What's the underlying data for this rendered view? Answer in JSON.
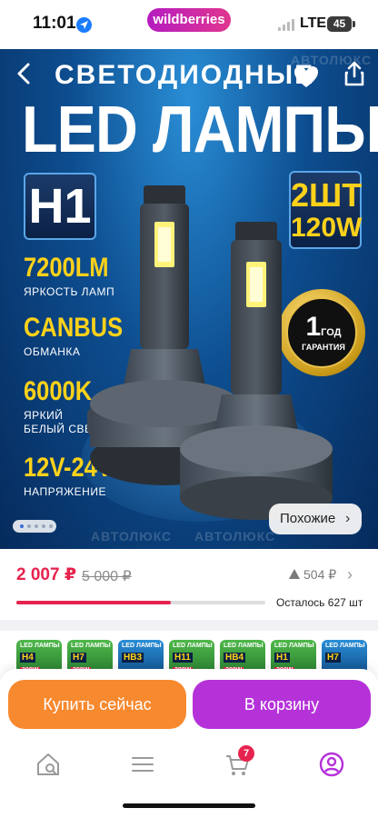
{
  "status_bar": {
    "time": "11:01",
    "brand": "wildberries",
    "network": "LTE",
    "battery": "45"
  },
  "hero": {
    "headline_top": "СВЕТОДИОДНЫЕ",
    "headline_main": "LED ЛАМПЫ",
    "base_type": "H1",
    "quantity": "2ШТ",
    "power": "120W",
    "specs": [
      {
        "value": "7200LM",
        "caption": "ЯРКОСТЬ ЛАМП"
      },
      {
        "value": "CANBUS",
        "caption": "ОБМАНКА"
      },
      {
        "value": "6000K",
        "caption": "ЯРКИЙ БЕЛЫЙ СВЕТ"
      },
      {
        "value": "12V-24V",
        "caption": "НАПРЯЖЕНИЕ"
      }
    ],
    "warranty_value": "1",
    "warranty_unit": "ГОД",
    "warranty_caption": "ГАРАНТИЯ",
    "watermark": "АВТОЛЮКС",
    "similar_label": "Похожие",
    "similar_arrow": "›",
    "gallery_count": 5,
    "gallery_active": 0
  },
  "price": {
    "current": "2 007 ₽",
    "old": "5 000 ₽",
    "trend": "504 ₽",
    "stock_text": "Осталось 627 шт",
    "stock_bar_fraction": 0.62,
    "accent": "#e6234e"
  },
  "variants": [
    {
      "title": "LED ЛАМПЫ",
      "base": "H4",
      "power": "200W",
      "theme": "green"
    },
    {
      "title": "LED ЛАМПЫ",
      "base": "H7",
      "power": "200W",
      "theme": "green"
    },
    {
      "title": "LED ЛАМПЫ",
      "base": "HB3",
      "power": "",
      "theme": "blue"
    },
    {
      "title": "LED ЛАМПЫ",
      "base": "H11",
      "power": "200W",
      "theme": "green"
    },
    {
      "title": "LED ЛАМПЫ",
      "base": "HB4",
      "power": "200W",
      "theme": "green"
    },
    {
      "title": "LED ЛАМПЫ",
      "base": "H1",
      "power": "200W",
      "theme": "green"
    },
    {
      "title": "LED ЛАМПЫ",
      "base": "H7",
      "power": "",
      "theme": "blue"
    }
  ],
  "actions": {
    "buy_now": "Купить сейчас",
    "add_to_cart": "В корзину",
    "buy_color": "#f7892f",
    "cart_color": "#b532d9"
  },
  "tabbar": {
    "cart_count": "7",
    "items": [
      "home-search-icon",
      "menu-icon",
      "cart-icon",
      "profile-icon"
    ]
  }
}
